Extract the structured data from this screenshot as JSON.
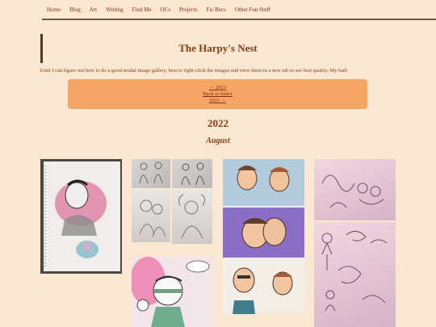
{
  "nav": {
    "items": [
      "Home",
      "Blog",
      "Art",
      "Writing",
      "Find Me",
      "OCs",
      "Projects",
      "Fic Recs",
      "Other Fun Stuff"
    ]
  },
  "header": {
    "title": "The Harpy's Nest"
  },
  "notice": "Until I can figure out how to do a good modal image gallery, best to right-click the images and view them in a new tab to see best quality. My bad!",
  "pager": {
    "prev": "← 2023",
    "index": "Back to Index",
    "next": "2021 →"
  },
  "section": {
    "year": "2022",
    "month": "August"
  },
  "colors": {
    "background": "#fbe8d3",
    "text": "#8a3c12",
    "pager_box": "#f5a665"
  }
}
